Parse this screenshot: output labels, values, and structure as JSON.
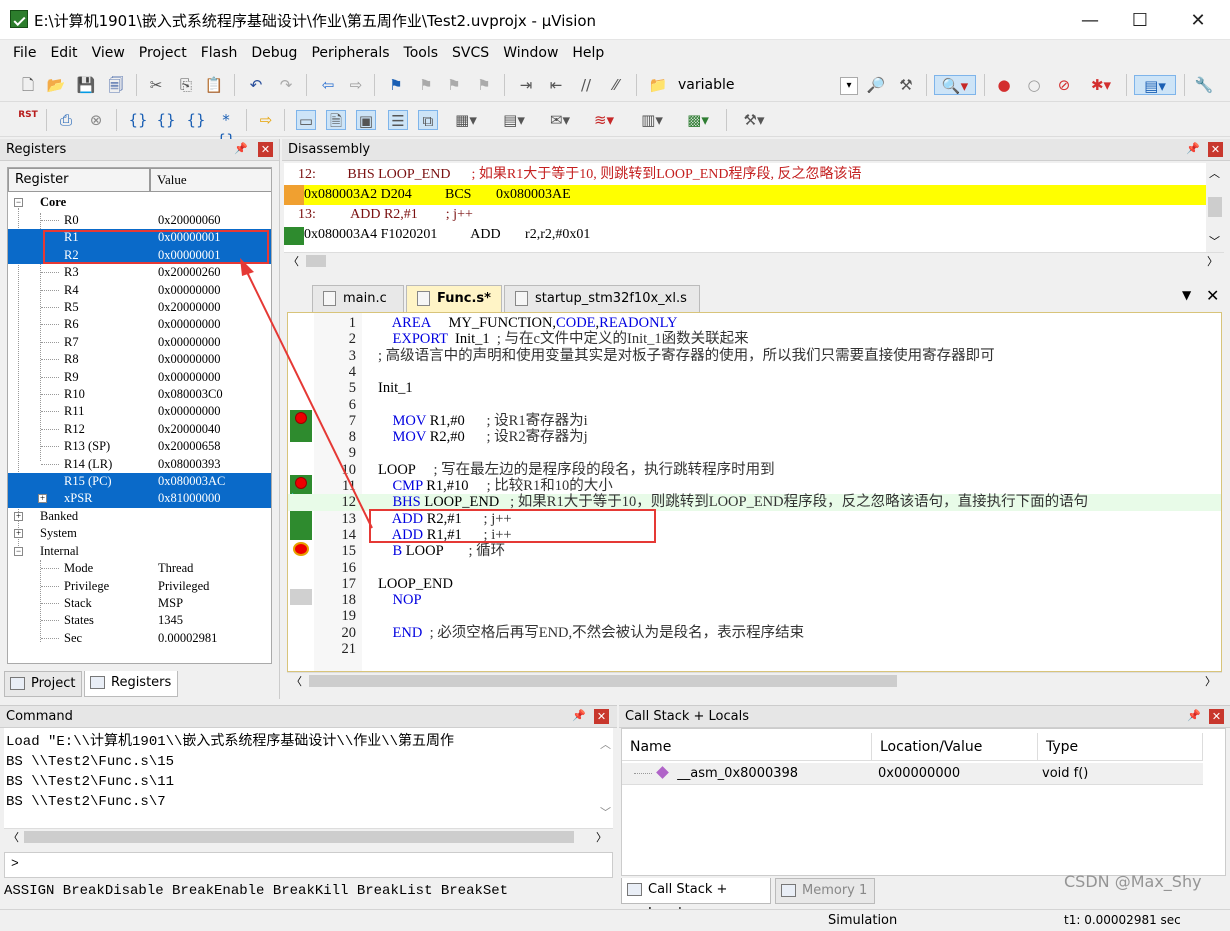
{
  "window": {
    "title": "E:\\计算机1901\\嵌入式系统程序基础设计\\作业\\第五周作业\\Test2.uvprojx - µVision",
    "minimize": "—",
    "maximize": "☐",
    "close": "✕"
  },
  "menu": [
    "File",
    "Edit",
    "View",
    "Project",
    "Flash",
    "Debug",
    "Peripherals",
    "Tools",
    "SVCS",
    "Window",
    "Help"
  ],
  "toolbar": {
    "find_value": "variable",
    "reset_label": "RST"
  },
  "registers_panel": {
    "title": "Registers",
    "col_register": "Register",
    "col_value": "Value",
    "groups": {
      "core": "Core",
      "banked": "Banked",
      "system": "System",
      "internal": "Internal"
    },
    "core": [
      {
        "name": "R0",
        "value": "0x20000060"
      },
      {
        "name": "R1",
        "value": "0x00000001"
      },
      {
        "name": "R2",
        "value": "0x00000001"
      },
      {
        "name": "R3",
        "value": "0x20000260"
      },
      {
        "name": "R4",
        "value": "0x00000000"
      },
      {
        "name": "R5",
        "value": "0x20000000"
      },
      {
        "name": "R6",
        "value": "0x00000000"
      },
      {
        "name": "R7",
        "value": "0x00000000"
      },
      {
        "name": "R8",
        "value": "0x00000000"
      },
      {
        "name": "R9",
        "value": "0x00000000"
      },
      {
        "name": "R10",
        "value": "0x080003C0"
      },
      {
        "name": "R11",
        "value": "0x00000000"
      },
      {
        "name": "R12",
        "value": "0x20000040"
      },
      {
        "name": "R13 (SP)",
        "value": "0x20000658"
      },
      {
        "name": "R14 (LR)",
        "value": "0x08000393"
      },
      {
        "name": "R15 (PC)",
        "value": "0x080003AC"
      },
      {
        "name": "xPSR",
        "value": "0x81000000"
      }
    ],
    "internal": [
      {
        "name": "Mode",
        "value": "Thread"
      },
      {
        "name": "Privilege",
        "value": "Privileged"
      },
      {
        "name": "Stack",
        "value": "MSP"
      },
      {
        "name": "States",
        "value": "1345"
      },
      {
        "name": "Sec",
        "value": "0.00002981"
      }
    ],
    "tab_project": "Project",
    "tab_registers": "Registers"
  },
  "disassembly": {
    "title": "Disassembly",
    "lines": [
      {
        "addr": "    12:",
        "op": "         BHS LOOP_END",
        "comment": "      ; 如果R1大于等于10, 则跳转到LOOP_END程序段, 反之忽略该语"
      },
      {
        "addr": "0x080003A2 D204",
        "op": "      BCS       0x080003AE",
        "comment": ""
      },
      {
        "addr": "    13:",
        "op": "          ADD R2,#1",
        "comment": "        ; j++"
      },
      {
        "addr": "0x080003A4 F1020201",
        "op": "  ADD       r2,r2,#0x01",
        "comment": ""
      }
    ]
  },
  "editor": {
    "tabs": [
      "main.c",
      "Func.s*",
      "startup_stm32f10x_xl.s"
    ],
    "lines": [
      {
        "n": "1",
        "i": "    ",
        "k": "AREA",
        "r": "     MY_FUNCTION,",
        "k2": "CODE",
        "r2": ",",
        "k3": "READONLY",
        "c": ""
      },
      {
        "n": "2",
        "i": "    ",
        "k": "EXPORT",
        "r": "  Init_1  ",
        "c": "; 与在c文件中定义的Init_1函数关联起来"
      },
      {
        "n": "3",
        "i": "",
        "k": "",
        "r": "",
        "c": "; 高级语言中的声明和使用变量其实是对板子寄存器的使用，所以我们只需要直接使用寄存器即可"
      },
      {
        "n": "4",
        "i": "",
        "k": "",
        "r": "",
        "c": ""
      },
      {
        "n": "5",
        "i": "",
        "k": "",
        "r": "Init_1",
        "c": ""
      },
      {
        "n": "6",
        "i": "",
        "k": "",
        "r": "",
        "c": ""
      },
      {
        "n": "7",
        "i": "    ",
        "k": "MOV",
        "r": " R1,#0      ",
        "c": "; 设R1寄存器为i"
      },
      {
        "n": "8",
        "i": "    ",
        "k": "MOV",
        "r": " R2,#0      ",
        "c": "; 设R2寄存器为j"
      },
      {
        "n": "9",
        "i": "",
        "k": "",
        "r": "",
        "c": ""
      },
      {
        "n": "10",
        "i": "",
        "k": "",
        "r": "LOOP     ",
        "c": "; 写在最左边的是程序段的段名，执行跳转程序时用到"
      },
      {
        "n": "11",
        "i": "    ",
        "k": "CMP",
        "r": " R1,#10     ",
        "c": "; 比较R1和10的大小"
      },
      {
        "n": "12",
        "i": "    ",
        "k": "BHS",
        "r": " LOOP_END   ",
        "c": "; 如果R1大于等于10，则跳转到LOOP_END程序段，反之忽略该语句，直接执行下面的语句"
      },
      {
        "n": "13",
        "i": "    ",
        "k": "ADD",
        "r": " R2,#1      ",
        "c": "; j++"
      },
      {
        "n": "14",
        "i": "    ",
        "k": "ADD",
        "r": " R1,#1      ",
        "c": "; i++"
      },
      {
        "n": "15",
        "i": "    ",
        "k": "B",
        "r": " LOOP       ",
        "c": "; 循环"
      },
      {
        "n": "16",
        "i": "",
        "k": "",
        "r": "",
        "c": ""
      },
      {
        "n": "17",
        "i": "",
        "k": "",
        "r": "LOOP_END",
        "c": ""
      },
      {
        "n": "18",
        "i": "    ",
        "k": "NOP",
        "r": "",
        "c": ""
      },
      {
        "n": "19",
        "i": "",
        "k": "",
        "r": "",
        "c": ""
      },
      {
        "n": "20",
        "i": "    ",
        "k": "END",
        "r": "  ",
        "c": "; 必须空格后再写END,不然会被认为是段名，表示程序结束"
      },
      {
        "n": "21",
        "i": "",
        "k": "",
        "r": "",
        "c": ""
      }
    ]
  },
  "command": {
    "title": "Command",
    "lines": [
      "Load \"E:\\\\计算机1901\\\\嵌入式系统程序基础设计\\\\作业\\\\第五周作",
      "BS \\\\Test2\\Func.s\\15",
      "BS \\\\Test2\\Func.s\\11",
      "BS \\\\Test2\\Func.s\\7"
    ],
    "prompt": ">",
    "hint": "ASSIGN BreakDisable BreakEnable BreakKill BreakList BreakSet"
  },
  "callstack": {
    "title": "Call Stack + Locals",
    "col_name": "Name",
    "col_location": "Location/Value",
    "col_type": "Type",
    "row": {
      "name": "__asm_0x8000398",
      "location": "0x00000000",
      "type": "void f()"
    },
    "tab_callstack": "Call Stack + Locals",
    "tab_memory": "Memory 1"
  },
  "status": {
    "mode": "Simulation",
    "time": "t1: 0.00002981 sec"
  },
  "watermark": "CSDN @Max_Shy",
  "colors": {
    "selection": "#0a6ac9",
    "current_line": "#ffff00",
    "executed": "#2e8b2e",
    "annotation": "#e53935"
  }
}
